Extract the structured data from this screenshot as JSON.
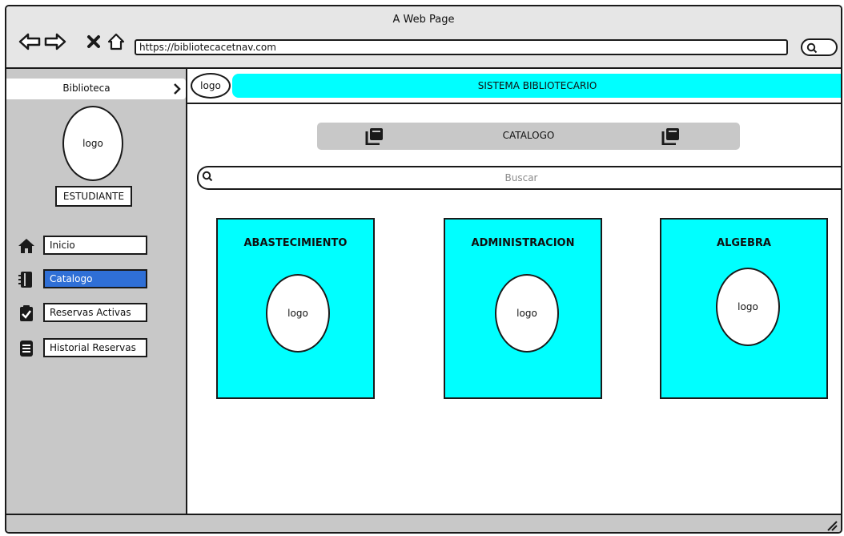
{
  "window": {
    "title": "A Web Page"
  },
  "browser": {
    "url": "https://bibliotecacetnav.com"
  },
  "sidebar": {
    "title": "Biblioteca",
    "avatar_label": "logo",
    "role_label": "ESTUDIANTE",
    "items": [
      {
        "label": "Inicio",
        "icon": "home-icon",
        "active": false
      },
      {
        "label": "Catalogo",
        "icon": "book-icon",
        "active": true
      },
      {
        "label": "Reservas Activas",
        "icon": "clipboard-check-icon",
        "active": false
      },
      {
        "label": "Historial Reservas",
        "icon": "document-icon",
        "active": false
      }
    ]
  },
  "header": {
    "logo_label": "logo",
    "title": "SISTEMA BIBLIOTECARIO"
  },
  "catalog": {
    "title": "CATALOGO"
  },
  "search": {
    "placeholder": "Buscar"
  },
  "cards": [
    {
      "title": "ABASTECIMIENTO",
      "logo_label": "logo"
    },
    {
      "title": "ADMINISTRACION",
      "logo_label": "logo"
    },
    {
      "title": "ALGEBRA",
      "logo_label": "logo"
    }
  ],
  "colors": {
    "accent": "#00ffff",
    "active_item": "#2f6fd6",
    "panel_gray": "#c8c8c8"
  }
}
